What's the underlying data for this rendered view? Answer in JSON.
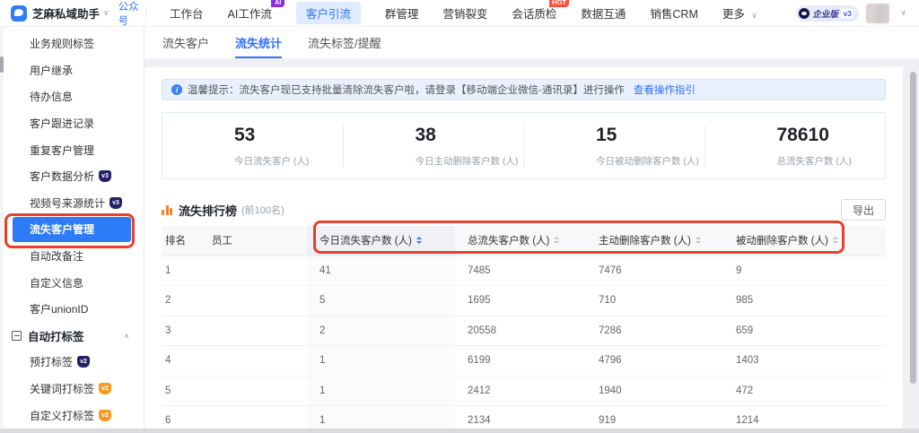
{
  "colors": {
    "accent_blue": "#3370FF",
    "annotation_red": "#E8402D",
    "active_sidebar_bg": "#2E7BF7",
    "badge_navy": "#232268",
    "badge_orange": "#F59A23",
    "badge_hot_red": "#FF4D3C",
    "badge_ai_purple": "#8B2BE2",
    "ranking_icon_orange": "#F5822A"
  },
  "topbar": {
    "app_name": "芝麻私域助手",
    "account_badge": "公众号",
    "nav": [
      {
        "label": "工作台"
      },
      {
        "label": "AI工作流",
        "badge": "AI"
      },
      {
        "label": "客户引流",
        "active": true
      },
      {
        "label": "群管理"
      },
      {
        "label": "营销裂变"
      },
      {
        "label": "会话质检",
        "badge": "HOT"
      },
      {
        "label": "数据互通"
      },
      {
        "label": "销售CRM"
      },
      {
        "label": "更多",
        "chevron": "∨"
      }
    ],
    "plan": {
      "name": "企业版",
      "version": "v3"
    }
  },
  "sidebar": {
    "items": [
      {
        "label": "业务规则标签"
      },
      {
        "label": "用户继承"
      },
      {
        "label": "待办信息"
      },
      {
        "label": "客户跟进记录"
      },
      {
        "label": "重复客户管理"
      },
      {
        "label": "客户数据分析",
        "badge": "v3"
      },
      {
        "label": "视频号来源统计",
        "badge": "v3"
      },
      {
        "label": "流失客户管理",
        "active": true
      },
      {
        "label": "自动改备注"
      },
      {
        "label": "自定义信息"
      },
      {
        "label": "客户unionID"
      },
      {
        "label": "自动打标签",
        "section": true,
        "collapse_icon": "∧"
      },
      {
        "label": "预打标签",
        "badge": "v2"
      },
      {
        "label": "关键词打标签",
        "badge": "v2"
      },
      {
        "label": "自定义打标签",
        "badge": "v2"
      }
    ]
  },
  "tabs": [
    {
      "label": "流失客户"
    },
    {
      "label": "流失统计",
      "active": true
    },
    {
      "label": "流失标签/提醒"
    }
  ],
  "notice": {
    "text": "温馨提示：流失客户现已支持批量清除流失客户啦，请登录【移动端企业微信-通讯录】进行操作",
    "link": "查看操作指引"
  },
  "stats": [
    {
      "value": "53",
      "label": "今日流失客户 (人)"
    },
    {
      "value": "38",
      "label": "今日主动删除客户数 (人)"
    },
    {
      "value": "15",
      "label": "今日被动删除客户数 (人)"
    },
    {
      "value": "78610",
      "label": "总流失客户数 (人)"
    }
  ],
  "ranking": {
    "title": "流失排行榜",
    "subtitle": "(前100名)",
    "export_label": "导出"
  },
  "table": {
    "headers": [
      {
        "label": "排名"
      },
      {
        "label": "员工"
      },
      {
        "label": "今日流失客户数 (人)",
        "sortable": true,
        "sort_active": true
      },
      {
        "label": "总流失客户数 (人)",
        "sortable": true
      },
      {
        "label": "主动删除客户数 (人)",
        "sortable": true
      },
      {
        "label": "被动删除客户数 (人)",
        "sortable": true
      }
    ],
    "rows": [
      {
        "rank": "1",
        "today": "41",
        "total": "7485",
        "active_del": "7476",
        "passive_del": "9"
      },
      {
        "rank": "2",
        "today": "5",
        "total": "1695",
        "active_del": "710",
        "passive_del": "985"
      },
      {
        "rank": "3",
        "today": "2",
        "total": "20558",
        "active_del": "7286",
        "passive_del": "659"
      },
      {
        "rank": "4",
        "today": "1",
        "total": "6199",
        "active_del": "4796",
        "passive_del": "1403"
      },
      {
        "rank": "5",
        "today": "1",
        "total": "2412",
        "active_del": "1940",
        "passive_del": "472"
      },
      {
        "rank": "6",
        "today": "1",
        "total": "2134",
        "active_del": "919",
        "passive_del": "1214"
      }
    ]
  }
}
